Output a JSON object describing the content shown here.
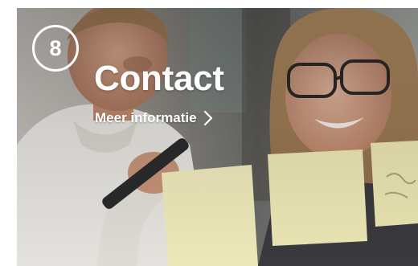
{
  "card": {
    "step_number": "8",
    "title": "Contact",
    "link_label": "Meer informatie",
    "link_icon": "chevron-right-icon",
    "photo": "two-people-placing-sticky-notes-on-glass-wall"
  },
  "colors": {
    "text": "#ffffff",
    "sticky_note": "#f1ecbd"
  }
}
